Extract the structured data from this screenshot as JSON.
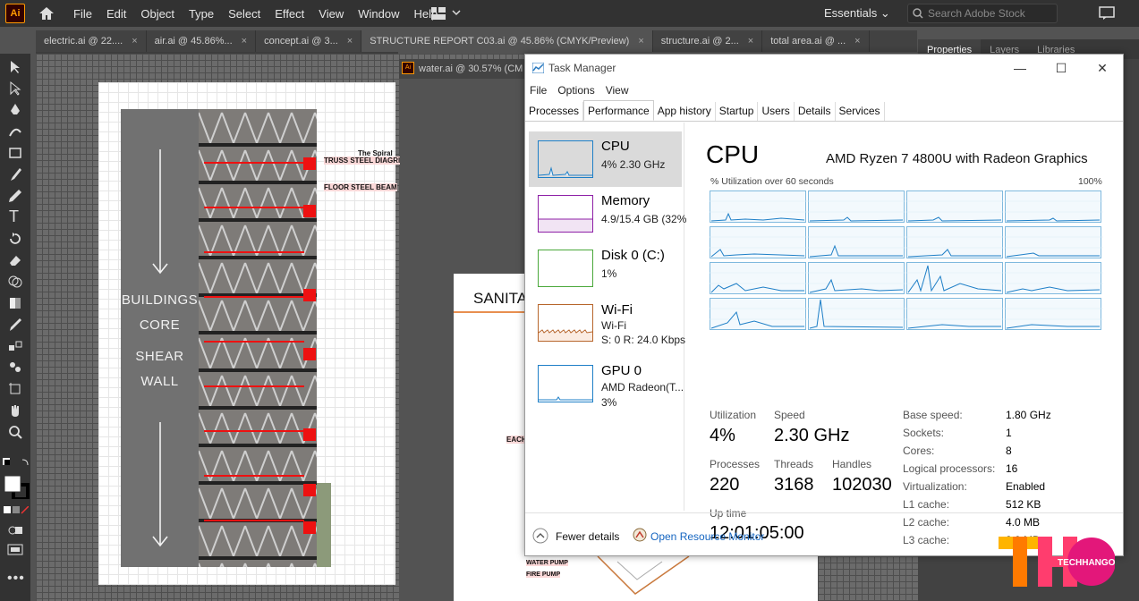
{
  "illustrator": {
    "menu": [
      "File",
      "Edit",
      "Object",
      "Type",
      "Select",
      "Effect",
      "View",
      "Window",
      "Help"
    ],
    "logo_text": "Ai",
    "workspace": "Essentials",
    "search_placeholder": "Search Adobe Stock",
    "tabs": [
      "electric.ai @ 22....",
      "air.ai @ 45.86%...",
      "concept.ai @ 3...",
      "STRUCTURE REPORT C03.ai @ 45.86% (CMYK/Preview)",
      "structure.ai @ 2...",
      "total area.ai @ ..."
    ],
    "panel_tabs": [
      "Properties",
      "Layers",
      "Libraries"
    ],
    "second_doc_tab": "water.ai @ 30.57% (CM",
    "artboard": {
      "core_lines": [
        "BUILDINGS",
        "CORE",
        "SHEAR",
        "WALL"
      ],
      "labels": [
        "The Spiral",
        "TRUSS STEEL DIAGRI",
        "FLOOR STEEL BEAM"
      ],
      "sanitary_title": "SANITA",
      "side_label": "EACH",
      "pump_labels": [
        "WATER PUMP",
        "FIRE PUMP"
      ]
    }
  },
  "task_manager": {
    "title": "Task Manager",
    "menu": [
      "File",
      "Options",
      "View"
    ],
    "tabs": [
      "Processes",
      "Performance",
      "App history",
      "Startup",
      "Users",
      "Details",
      "Services"
    ],
    "active_tab": "Performance",
    "side_items": [
      {
        "name": "CPU",
        "sub1": "4% 2.30 GHz",
        "sub2": "",
        "color": "#1e7fc7"
      },
      {
        "name": "Memory",
        "sub1": "4.9/15.4 GB (32%",
        "sub2": "",
        "color": "#8e1fa6"
      },
      {
        "name": "Disk 0 (C:)",
        "sub1": "1%",
        "sub2": "",
        "color": "#4aa83a"
      },
      {
        "name": "Wi-Fi",
        "sub1": "Wi-Fi",
        "sub2": "S: 0  R: 24.0 Kbps",
        "color": "#b7662c"
      },
      {
        "name": "GPU 0",
        "sub1": "AMD Radeon(T...",
        "sub2": "3%",
        "color": "#1e7fc7"
      }
    ],
    "main": {
      "title": "CPU",
      "model": "AMD Ryzen 7 4800U with Radeon Graphics",
      "graph_caption": "% Utilization over 60 seconds",
      "graph_max": "100%",
      "stats": [
        {
          "label": "Utilization",
          "value": "4%"
        },
        {
          "label": "Speed",
          "value": "2.30 GHz"
        },
        {
          "label": "Processes",
          "value": "220"
        },
        {
          "label": "Threads",
          "value": "3168"
        },
        {
          "label": "Handles",
          "value": "102030"
        },
        {
          "label": "Up time",
          "value": "12:01:05:00"
        }
      ],
      "details": [
        {
          "k": "Base speed:",
          "v": "1.80 GHz"
        },
        {
          "k": "Sockets:",
          "v": "1"
        },
        {
          "k": "Cores:",
          "v": "8"
        },
        {
          "k": "Logical processors:",
          "v": "16"
        },
        {
          "k": "Virtualization:",
          "v": "Enabled"
        },
        {
          "k": "L1 cache:",
          "v": "512 KB"
        },
        {
          "k": "L2 cache:",
          "v": "4.0 MB"
        },
        {
          "k": "L3 cache:",
          "v": "8.0 MB"
        }
      ]
    },
    "footer": {
      "fewer": "Fewer details",
      "monitor": "Open Resource Monitor"
    }
  },
  "watermark": {
    "big": "THO",
    "small": "TECHHANGOUT"
  }
}
